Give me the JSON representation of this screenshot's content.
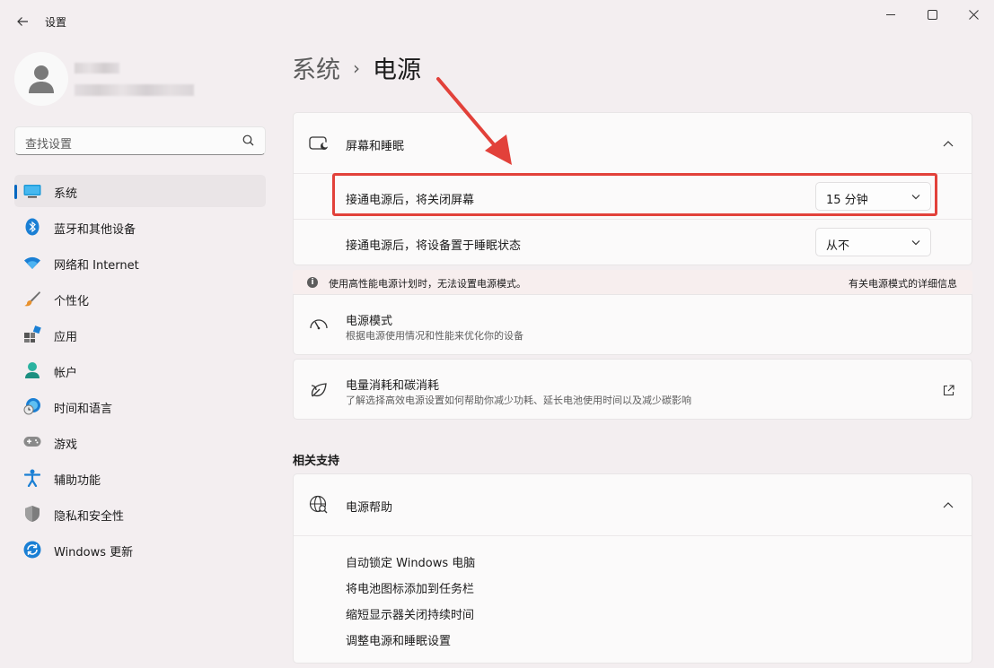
{
  "window": {
    "title": "设置"
  },
  "search": {
    "placeholder": "查找设置"
  },
  "sidebar": {
    "items": [
      {
        "label": "系统",
        "icon": "system-display-icon",
        "active": true
      },
      {
        "label": "蓝牙和其他设备",
        "icon": "bluetooth-icon"
      },
      {
        "label": "网络和 Internet",
        "icon": "wifi-icon"
      },
      {
        "label": "个性化",
        "icon": "paintbrush-icon"
      },
      {
        "label": "应用",
        "icon": "apps-icon"
      },
      {
        "label": "帐户",
        "icon": "account-icon"
      },
      {
        "label": "时间和语言",
        "icon": "globe-clock-icon"
      },
      {
        "label": "游戏",
        "icon": "gamepad-icon"
      },
      {
        "label": "辅助功能",
        "icon": "accessibility-icon"
      },
      {
        "label": "隐私和安全性",
        "icon": "shield-icon"
      },
      {
        "label": "Windows 更新",
        "icon": "update-icon"
      }
    ]
  },
  "breadcrumb": {
    "parent": "系统",
    "separator": "›",
    "current": "电源"
  },
  "screen_sleep": {
    "title": "屏幕和睡眠",
    "rows": [
      {
        "label": "接通电源后，将关闭屏幕",
        "value": "15 分钟"
      },
      {
        "label": "接通电源后，将设备置于睡眠状态",
        "value": "从不"
      }
    ]
  },
  "info_bar": {
    "text": "使用高性能电源计划时，无法设置电源模式。",
    "link": "有关电源模式的详细信息"
  },
  "power_mode": {
    "title": "电源模式",
    "subtitle": "根据电源使用情况和性能来优化你的设备"
  },
  "energy": {
    "title": "电量消耗和碳消耗",
    "subtitle": "了解选择高效电源设置如何帮助你减少功耗、延长电池使用时间以及减少碳影响"
  },
  "related": {
    "section_title": "相关支持",
    "help_title": "电源帮助",
    "links": [
      "自动锁定 Windows 电脑",
      "将电池图标添加到任务栏",
      "缩短显示器关闭持续时间",
      "调整电源和睡眠设置"
    ]
  },
  "colors": {
    "accent": "#0067c0",
    "annotation": "#e2413a"
  }
}
